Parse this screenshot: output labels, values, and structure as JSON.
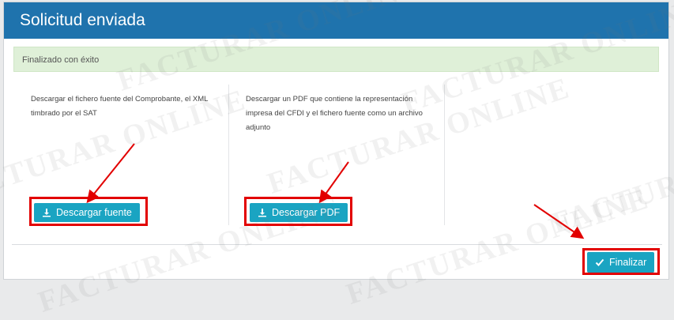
{
  "header": {
    "title": "Solicitud enviada"
  },
  "alert": {
    "text": "Finalizado con éxito"
  },
  "columns": [
    {
      "description": "Descargar el fichero fuente del Comprobante, el XML timbrado por el SAT",
      "button_label": "Descargar fuente",
      "button_icon": "download-icon"
    },
    {
      "description": "Descargar un PDF que contiene la representación impresa del CFDI y el fichero fuente como un archivo adjunto",
      "button_label": "Descargar PDF",
      "button_icon": "download-icon"
    }
  ],
  "footer": {
    "finish_label": "Finalizar",
    "finish_icon": "check-icon"
  },
  "watermark": {
    "text": "FACTURAR ONLINE"
  },
  "colors": {
    "header": "#1f73ad",
    "button": "#1aa4c2",
    "alert_bg": "#dff0d8",
    "highlight": "#e20000"
  }
}
